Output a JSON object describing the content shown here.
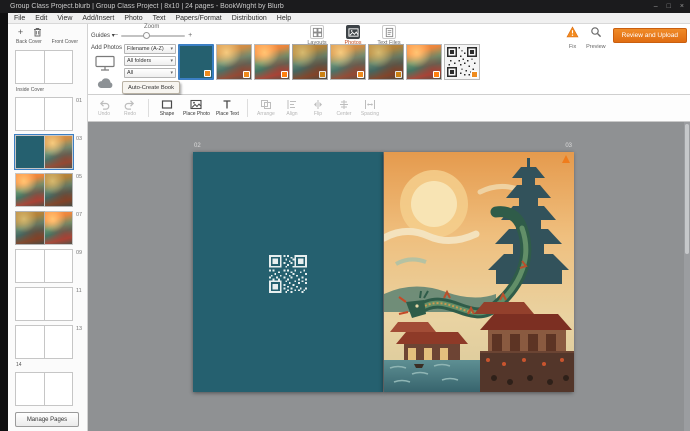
{
  "titlebar": {
    "title": "Group Class Project.blurb | Group Class Project | 8x10 | 24 pages - BookWright by Blurb",
    "minimize_icon": "–",
    "maximize_icon": "□",
    "close_icon": "×"
  },
  "menubar": {
    "items": [
      "File",
      "Edit",
      "View",
      "Add/Insert",
      "Photo",
      "Text",
      "Papers/Format",
      "Distribution",
      "Help"
    ]
  },
  "panel": {
    "guides_label": "Guides",
    "caret_icon": "▾",
    "zoom_label": "Zoom",
    "zoom_out_icon": "−",
    "zoom_in_icon": "+",
    "add_photos_label": "Add Photos",
    "add_photos_plus_icon": "+",
    "sort_select_value": "Filename (A-Z)",
    "folders_select_value": "All folders",
    "filter_select_value": "All",
    "auto_create_button_label": "Auto-Create Book",
    "tab_layouts_label": "Layouts",
    "tab_photos_label": "Photos",
    "tab_text_files_label": "Text Files",
    "fix_label": "Fix",
    "preview_label": "Preview",
    "review_upload_button_label": "Review and Upload"
  },
  "toolbar": {
    "undo_label": "Undo",
    "redo_label": "Redo",
    "shape_label": "Shape",
    "place_photo_label": "Place Photo",
    "place_text_label": "Place Text",
    "arrange_label": "Arrange",
    "align_label": "Align",
    "flip_label": "Flip",
    "center_label": "Center",
    "spacing_label": "Spacing"
  },
  "sidebar": {
    "back_cover_label": "Back Cover",
    "front_cover_label": "Front Cover",
    "inside_cover_label": "Inside Cover",
    "spread_numbers": [
      "01",
      "03",
      "05",
      "07",
      "09",
      "11",
      "13"
    ],
    "last_page_number": "14",
    "manage_pages_button_label": "Manage Pages"
  },
  "canvas": {
    "left_page_number": "02",
    "right_page_number": "03"
  },
  "colors": {
    "accent_orange": "#ee7d1d",
    "page_teal": "#25606f",
    "canvas_background": "#8f9193",
    "selection_blue": "#3b7fc4",
    "active_tab_background": "#3d4347"
  }
}
